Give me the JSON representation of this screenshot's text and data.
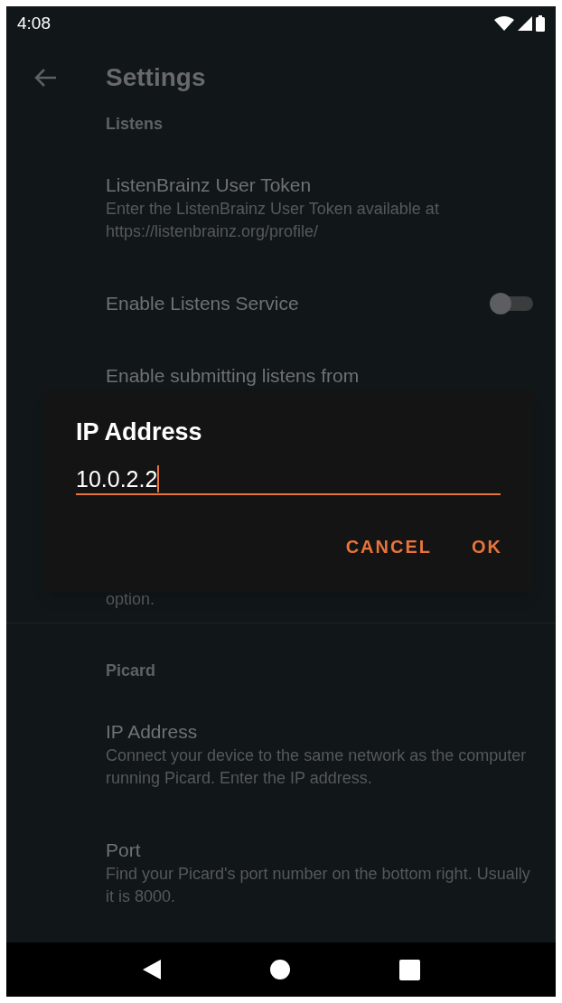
{
  "status_bar": {
    "time": "4:08"
  },
  "toolbar": {
    "title": "Settings"
  },
  "sections": [
    {
      "header": "Listens",
      "items": [
        {
          "kind": "text",
          "title": "ListenBrainz User Token",
          "summary": "Enter the ListenBrainz User Token available at https://listenbrainz.org/profile/"
        },
        {
          "kind": "switch",
          "title": "Enable Listens Service",
          "on": false
        },
        {
          "kind": "covered",
          "title": "Enable submitting listens from",
          "summary": "option."
        }
      ]
    },
    {
      "header": "Picard",
      "items": [
        {
          "kind": "text",
          "title": "IP Address",
          "summary": "Connect your device to the same network as the computer running Picard. Enter the IP address."
        },
        {
          "kind": "text",
          "title": "Port",
          "summary": "Find your Picard's port number on the bottom right. Usually it is 8000."
        }
      ]
    }
  ],
  "dialog": {
    "title": "IP Address",
    "value": "10.0.2.2",
    "buttons": [
      "CANCEL",
      "OK"
    ]
  }
}
